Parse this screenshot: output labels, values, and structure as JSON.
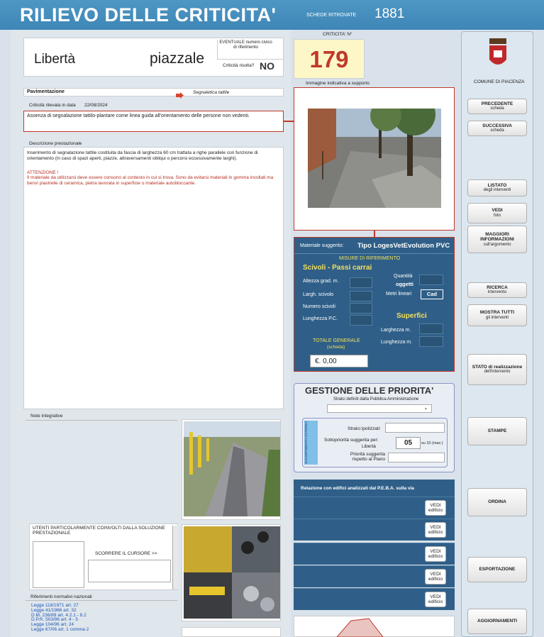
{
  "header": {
    "title": "RILIEVO DELLE CRITICITA'",
    "schede_label": "SCHEDE RITROVATE",
    "schede_count": "1881"
  },
  "address": {
    "street": "Libertà",
    "type": "piazzale",
    "civico_label": "EVENTUALE numero civico di riferimento",
    "risolta_label": "Criticità risolta?",
    "risolta_value": "NO"
  },
  "criticita": {
    "label": "CRITICITA' N°",
    "number": "179",
    "image_caption": "Immagine indicativa a supporto"
  },
  "category": {
    "main": "Pavimentazione",
    "sub": "Segnaletica tattile"
  },
  "detection": {
    "label": "Criticità rilevata in data",
    "date": "22/08/2024"
  },
  "problem_text": "Assenza di segnalazione tattilo-plantare come linea guida all'orientamento delle persone non vedenti.",
  "description": {
    "label": "Descrizione prestazionale",
    "text": "Inserimento di segnalazione tattile costituita da fascia di larghezza 60 cm trattata a righe parallele con funzione di orientamento (in caso di spazi aperti, piazze, attraversamenti obliqui o percorsi eccessivamente larghi).",
    "warning_title": "ATTENZIONE !",
    "warning_text": "Il materiale da utilizzarsi deve essere consono al contesto in cui si trova. Sono da evitarsi materiali in gomma incollati ma bensì piastrelle di ceramica, pietra lavorata in superficie o materiale autobloccante."
  },
  "notes": {
    "label": "Note integrative"
  },
  "users": {
    "title": "UTENTI PARTICOLARMENTE COINVOLTI DALLA SOLUZIONE PRESTAZIONALE",
    "scroll_hint": "SCORRERE IL CURSORE >>"
  },
  "refs": {
    "label": "Riferimenti normativi nazionali",
    "items": [
      "Legge 118/1971 art. 27",
      "Legge 41/1986 art. 32",
      "D.M. 236/89 art. 4.2.1 - 8.2",
      "D.P.R. 503/96 art. 4 - 5",
      "Legge 104/96 art. 24",
      "Legge 67/06 art. 1 comma 2"
    ]
  },
  "material": {
    "label": "Materiale suggerito:",
    "value": "Tipo LogesVetEvolution PVC",
    "measures_title": "MISURE DI RIFERIMENTO",
    "scivoli_title": "Scivoli - Passi carrai",
    "altezza": "Altezza grad. m.",
    "largh": "Largh. scivolo",
    "numero": "Numero scivoli",
    "lunghezza_pc": "Lunghezza P.C.",
    "quantita": "Quantità",
    "oggetti": "oggetti",
    "metri": "Metri lineari",
    "cad": "Cad",
    "superfici": "Superfici",
    "larghezza": "Larghezza m.",
    "lunghezza": "Lunghezza m.",
    "totale": "TOTALE GENERALE",
    "scheda": "(scheda)",
    "total_value": "€. 0,00"
  },
  "priority": {
    "title": "GESTIONE DELLE PRIORITA'",
    "stralci_label": "Stralci definiti dalla Pubblica Amministrazione",
    "suggerimento": "SUGGERIMENTO ESTERNO",
    "ipotizzati": "Stralci ipotizzati:",
    "sotto_label": "Sottopriorità suggerita per:",
    "sotto_place": "Libertà",
    "sotto_value": "05",
    "su10": "su 10 (max.)",
    "piano_label": "Priorità suggerita rispetto al Piano"
  },
  "relations": {
    "title": "Relazione con edifici analizzati dal P.E.B.A. sulla via",
    "vedi": "VEDI",
    "edificio": "edificio"
  },
  "sidebar": {
    "comune": "COMUNE DI PIACENZA",
    "buttons": [
      {
        "t": "PRECEDENTE",
        "s": "scheda"
      },
      {
        "t": "SUCCESSIVA",
        "s": "scheda"
      },
      {
        "t": "LISTATO",
        "s": "degli interventi"
      },
      {
        "t": "VEDI",
        "s": "foto"
      },
      {
        "t": "MAGGIORI INFORMAZIONI",
        "s": "sull'argomento"
      },
      {
        "t": "RICERCA",
        "s": "intervento"
      },
      {
        "t": "MOSTRA TUTTI",
        "s": "gli interventi"
      },
      {
        "t": "STATO di realizzazione",
        "s": "dell'intervento"
      },
      {
        "t": "STAMPE",
        "s": ""
      },
      {
        "t": "ORDINA",
        "s": ""
      },
      {
        "t": "ESPORTAZIONE",
        "s": ""
      },
      {
        "t": "AGGIORNAMENTI",
        "s": ""
      }
    ]
  },
  "colors": {
    "header": "#4e97c4",
    "panel": "#2f5f88",
    "accent_red": "#c0392b",
    "number": "#c0392b",
    "number_bg": "#fdf7c8"
  }
}
